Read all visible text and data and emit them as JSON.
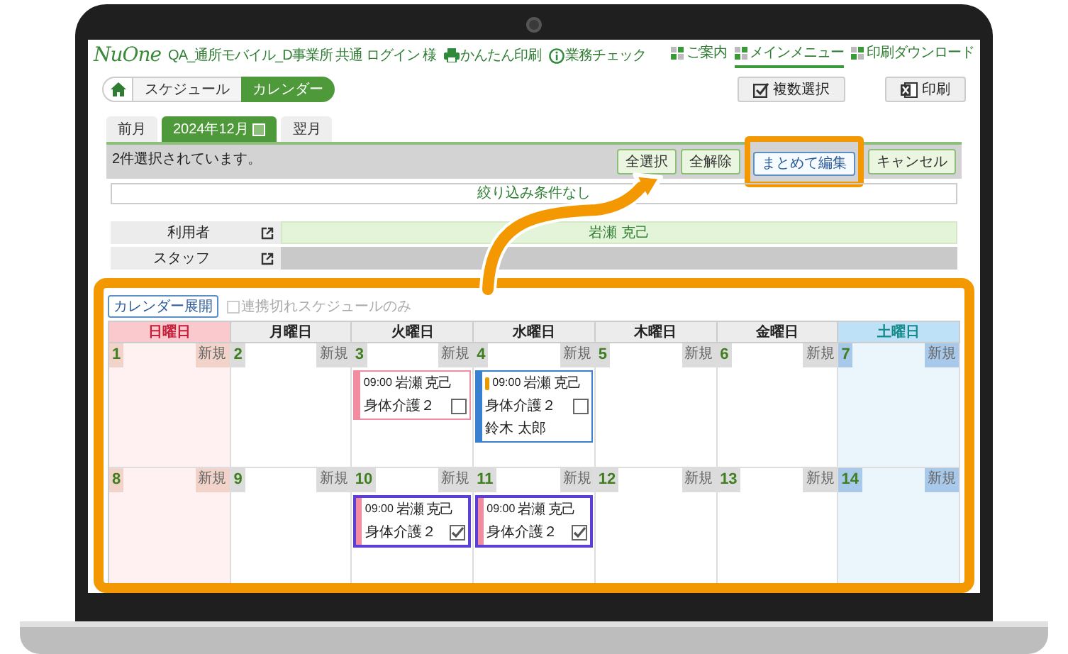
{
  "header": {
    "logo": "NuOne",
    "user": "QA_通所モバイル_D事業所 共通 ログイン 様",
    "links": [
      {
        "label": "かんたん印刷",
        "kind": "printer"
      },
      {
        "label": "業務チェック",
        "kind": "info"
      }
    ],
    "nav": [
      {
        "label": "ご案内",
        "selected": false
      },
      {
        "label": "メインメニュー",
        "selected": true
      },
      {
        "label": "印刷ダウンロード",
        "selected": false
      }
    ]
  },
  "breadcrumb": [
    {
      "label": "スケジュール",
      "selected": false
    },
    {
      "label": "カレンダー",
      "selected": true
    }
  ],
  "actions": [
    {
      "label": "複数選択",
      "kind": "multi_select"
    },
    {
      "label": "印刷",
      "kind": "spreadsheet"
    }
  ],
  "month_tabs": [
    {
      "label": "前月",
      "selected": false
    },
    {
      "label": "2024年12月",
      "selected": true
    },
    {
      "label": "翌月",
      "selected": false
    }
  ],
  "selection_bar": {
    "message": "2件選択されています。",
    "buttons": [
      {
        "label": "全選択",
        "highlighted": false
      },
      {
        "label": "全解除",
        "highlighted": false
      },
      {
        "label": "まとめて編集",
        "highlighted": true
      },
      {
        "label": "キャンセル",
        "highlighted": false
      }
    ]
  },
  "filter": {
    "summary": "絞り込み条件なし",
    "rows": [
      {
        "label": "利用者",
        "value": "岩瀬 克己"
      },
      {
        "label": "スタッフ"
      }
    ]
  },
  "calendar": {
    "expand_button": "カレンダー展開",
    "only_unlinked": {
      "label": "連携切れスケジュールのみ",
      "checked": false,
      "disabled": true
    },
    "weekdays": [
      {
        "label": "日曜日",
        "kind": "sunday"
      },
      {
        "label": "月曜日",
        "kind": "weekday"
      },
      {
        "label": "火曜日",
        "kind": "weekday"
      },
      {
        "label": "水曜日",
        "kind": "weekday"
      },
      {
        "label": "木曜日",
        "kind": "weekday"
      },
      {
        "label": "金曜日",
        "kind": "weekday"
      },
      {
        "label": "土曜日",
        "kind": "saturday"
      }
    ],
    "weeks": [
      [
        {
          "day": "1",
          "new_label": "新規"
        },
        {
          "day": "2",
          "new_label": "新規"
        },
        {
          "day": "3",
          "new_label": "新規",
          "events": [
            {
              "time": "09:00",
              "client": "岩瀬 克己",
              "service": "身体介護２",
              "color": "#f28ca0",
              "selected": false,
              "checked": false,
              "warning": false
            }
          ]
        },
        {
          "day": "4",
          "new_label": "新規",
          "events": [
            {
              "time": "09:00",
              "client": "岩瀬 克己",
              "service": "身体介護２",
              "staff": "鈴木 太郎",
              "color": "#3a80d0",
              "selected": false,
              "checked": false,
              "warning": true
            }
          ]
        },
        {
          "day": "5",
          "new_label": "新規"
        },
        {
          "day": "6",
          "new_label": "新規"
        },
        {
          "day": "7",
          "new_label": "新規"
        }
      ],
      [
        {
          "day": "8",
          "new_label": "新規"
        },
        {
          "day": "9",
          "new_label": "新規"
        },
        {
          "day": "10",
          "new_label": "新規",
          "events": [
            {
              "time": "09:00",
              "client": "岩瀬 克己",
              "service": "身体介護２",
              "color": "#f28ca0",
              "selected": true,
              "checked": true,
              "warning": false
            }
          ]
        },
        {
          "day": "11",
          "new_label": "新規",
          "events": [
            {
              "time": "09:00",
              "client": "岩瀬 克己",
              "service": "身体介護２",
              "color": "#f28ca0",
              "selected": true,
              "checked": true,
              "warning": false
            }
          ]
        },
        {
          "day": "12",
          "new_label": "新規"
        },
        {
          "day": "13",
          "new_label": "新規"
        },
        {
          "day": "14",
          "new_label": "新規"
        }
      ]
    ]
  }
}
